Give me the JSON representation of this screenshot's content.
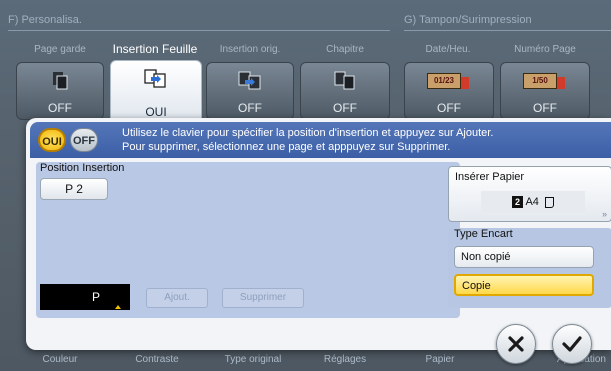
{
  "background": {
    "section_left": "F) Personalisa.",
    "section_right": "G) Tampon/Surimpression",
    "tabs": [
      {
        "label": "Page garde",
        "state": "OFF",
        "icon": "page-garde-icon"
      },
      {
        "label": "Insertion Feuille",
        "state": "OUI",
        "icon": "insertion-feuille-icon",
        "active": true
      },
      {
        "label": "Insertion orig.",
        "state": "OFF",
        "icon": "insertion-orig-icon"
      },
      {
        "label": "Chapitre",
        "state": "OFF",
        "icon": "chapitre-icon"
      },
      {
        "label": "Date/Heu.",
        "state": "OFF",
        "icon": "date-heure-icon",
        "badge": "01/23"
      },
      {
        "label": "Numéro Page",
        "state": "OFF",
        "icon": "numero-page-icon",
        "badge": "1/50"
      }
    ],
    "bottom_labels": [
      "Couleur",
      "Contraste",
      "Type original",
      "Réglages",
      "Papier",
      "Application"
    ]
  },
  "dialog": {
    "toggle_on": "OUI",
    "toggle_off": "OFF",
    "message_line1": "Utilisez le clavier pour spécifier la position d'insertion et appuyez sur Ajouter.",
    "message_line2": "Pour supprimer, sélectionnez une page et apppuyez sur Supprimer.",
    "position_label": "Position Insertion",
    "page_entry": "P 2",
    "input_prefix": "P",
    "add_button": "Ajout.",
    "delete_button": "Supprimer",
    "paper": {
      "title": "Insérer Papier",
      "value": "A4",
      "value_number": "2"
    },
    "encart": {
      "title": "Type Encart",
      "options": [
        "Non copié",
        "Copie"
      ],
      "selected": "Copie"
    }
  },
  "colors": {
    "accent_blue": "#3c5ea6",
    "selected_yellow": "#ffd84a",
    "panel_blue": "#b9c8e4"
  }
}
